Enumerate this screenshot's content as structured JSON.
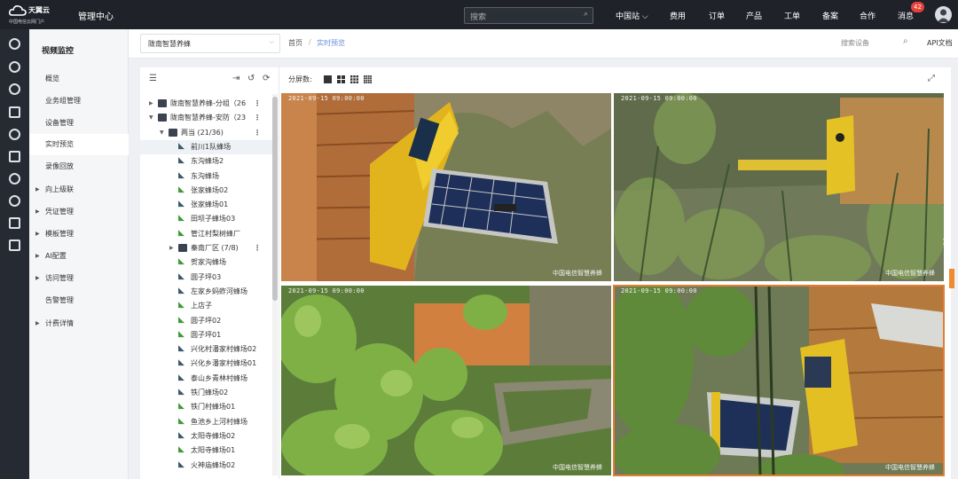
{
  "topbar": {
    "brand": "天翼云",
    "brand_sub": "e Cloud",
    "portal": "中国电信云网门户",
    "console": "管理中心",
    "search_placeholder": "搜索",
    "nav": [
      "中国站",
      "费用",
      "订单",
      "产品",
      "工单",
      "备案",
      "合作",
      "消息"
    ],
    "message_count": "42"
  },
  "sidebar": {
    "title": "视频监控",
    "items": [
      {
        "label": "概览",
        "expandable": false
      },
      {
        "label": "业务组管理",
        "expandable": false
      },
      {
        "label": "设备管理",
        "expandable": false
      },
      {
        "label": "实时预览",
        "expandable": false,
        "active": true
      },
      {
        "label": "录像回放",
        "expandable": false
      },
      {
        "label": "向上级联",
        "expandable": true
      },
      {
        "label": "凭证管理",
        "expandable": true
      },
      {
        "label": "模板管理",
        "expandable": true
      },
      {
        "label": "AI配置",
        "expandable": true
      },
      {
        "label": "访问管理",
        "expandable": true
      },
      {
        "label": "告警管理",
        "expandable": false
      },
      {
        "label": "计费详情",
        "expandable": true
      }
    ]
  },
  "breadcrumb": {
    "project": "陇南智慧养蜂",
    "home": "首页",
    "separator": "/",
    "current": "实时预览",
    "device_search_placeholder": "搜索设备",
    "api": "API文档"
  },
  "tree": {
    "rows": [
      {
        "label": "陇南智慧养蜂-分组（26",
        "type": "group",
        "expanded": false,
        "level": 0
      },
      {
        "label": "陇南智慧养蜂-安防（23",
        "type": "group",
        "expanded": true,
        "level": 0
      },
      {
        "label": "两当 (21/36)",
        "type": "folder",
        "expanded": true,
        "level": 1
      },
      {
        "label": "前川1队蜂场",
        "type": "cam",
        "online": false,
        "level": 2,
        "selected": true
      },
      {
        "label": "东沟蜂场2",
        "type": "cam",
        "online": false,
        "level": 2
      },
      {
        "label": "东沟蜂场",
        "type": "cam",
        "online": false,
        "level": 2
      },
      {
        "label": "张家蜂场02",
        "type": "cam",
        "online": true,
        "level": 2
      },
      {
        "label": "张家蜂场01",
        "type": "cam",
        "online": false,
        "level": 2
      },
      {
        "label": "田坝子蜂场03",
        "type": "cam",
        "online": true,
        "level": 2
      },
      {
        "label": "管江村梨树蜂厂",
        "type": "cam",
        "online": true,
        "level": 2
      },
      {
        "label": "秦南厂区 (7/8)",
        "type": "folder",
        "expanded": false,
        "level": 2
      },
      {
        "label": "贺家沟蜂场",
        "type": "cam",
        "online": true,
        "level": 2
      },
      {
        "label": "圆子坪03",
        "type": "cam",
        "online": false,
        "level": 2
      },
      {
        "label": "左家乡蚂蚱河蜂场",
        "type": "cam",
        "online": false,
        "level": 2
      },
      {
        "label": "上店子",
        "type": "cam",
        "online": true,
        "level": 2
      },
      {
        "label": "圆子坪02",
        "type": "cam",
        "online": true,
        "level": 2
      },
      {
        "label": "圆子坪01",
        "type": "cam",
        "online": true,
        "level": 2
      },
      {
        "label": "兴化村潘家村蜂场02",
        "type": "cam",
        "online": false,
        "level": 2
      },
      {
        "label": "兴化乡潘家村蜂场01",
        "type": "cam",
        "online": false,
        "level": 2
      },
      {
        "label": "泰山乡青林村蜂场",
        "type": "cam",
        "online": false,
        "level": 2
      },
      {
        "label": "铁门蜂场02",
        "type": "cam",
        "online": false,
        "level": 2
      },
      {
        "label": "铁门村蜂场01",
        "type": "cam",
        "online": true,
        "level": 2
      },
      {
        "label": "鱼池乡上河村蜂场",
        "type": "cam",
        "online": true,
        "level": 2
      },
      {
        "label": "太阳寺蜂场02",
        "type": "cam",
        "online": false,
        "level": 2
      },
      {
        "label": "太阳寺蜂场01",
        "type": "cam",
        "online": true,
        "level": 2
      },
      {
        "label": "火神庙蜂场02",
        "type": "cam",
        "online": false,
        "level": 2
      }
    ]
  },
  "video": {
    "split_label": "分屏数:",
    "feeds": [
      {
        "time": "2021-09-15 09:00:00",
        "name": "中国电信智慧养蜂"
      },
      {
        "time": "2021-09-15 09:00:00",
        "name": "中国电信智慧养蜂"
      },
      {
        "time": "2021-09-15 09:00:00",
        "name": "中国电信智慧养蜂"
      },
      {
        "time": "2021-09-15 09:00:00",
        "name": "中国电信智慧养蜂"
      }
    ]
  },
  "colors": {
    "accent": "#e27d35",
    "online": "#3f9b39",
    "offline": "#3d5a6b",
    "topbar": "#1f2229"
  }
}
